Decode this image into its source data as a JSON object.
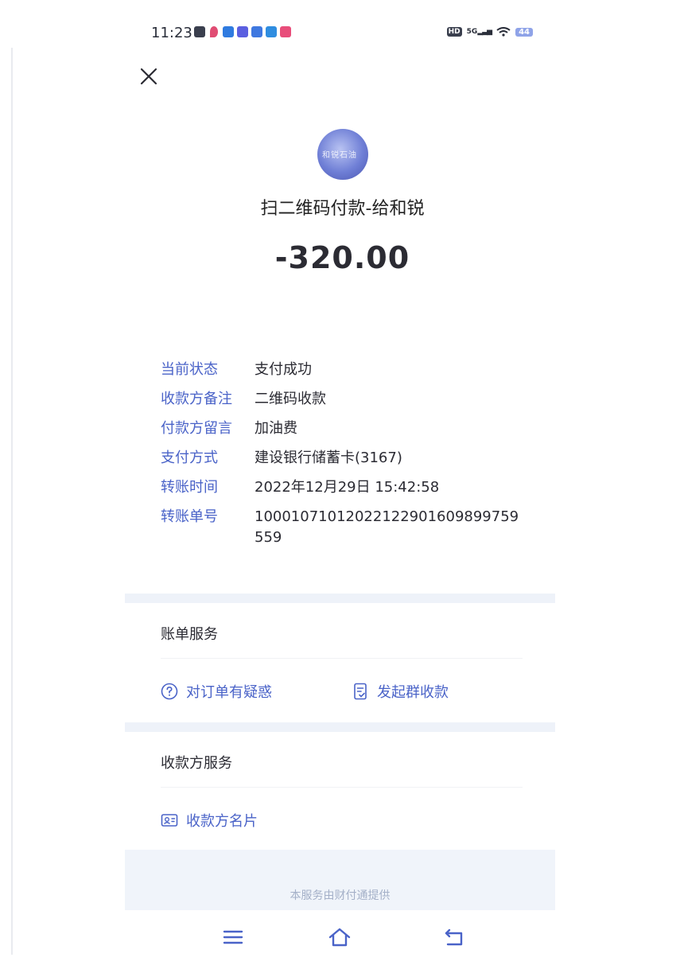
{
  "status_bar": {
    "time": "11:23",
    "signal_label": "5G",
    "hd_label": "HD",
    "battery": "44",
    "app_icon_colors": [
      "#3a3f4e",
      "#e04c73",
      "#2f7be0",
      "#5b5fe0",
      "#3f78e0",
      "#2f8de0",
      "#e84d7a"
    ]
  },
  "header": {
    "close_icon": "close-icon",
    "avatar_text": "和锐石油",
    "title": "扫二维码付款-给和锐",
    "amount": "-320.00"
  },
  "details": [
    {
      "label": "当前状态",
      "value": "支付成功"
    },
    {
      "label": "收款方备注",
      "value": "二维码收款"
    },
    {
      "label": "付款方留言",
      "value": "加油费"
    },
    {
      "label": "支付方式",
      "value": "建设银行储蓄卡(3167)"
    },
    {
      "label": "转账时间",
      "value": "2022年12月29日 15:42:58"
    },
    {
      "label": "转账单号",
      "value": "10001071012022122901609899759559"
    }
  ],
  "bill_service": {
    "title": "账单服务",
    "actions": [
      {
        "label": "对订单有疑惑",
        "icon": "question-circle-icon"
      },
      {
        "label": "发起群收款",
        "icon": "checklist-doc-icon"
      }
    ]
  },
  "payee_service": {
    "title": "收款方服务",
    "actions": [
      {
        "label": "收款方名片",
        "icon": "contact-card-icon"
      }
    ]
  },
  "footer": {
    "provider_text": "本服务由财付通提供"
  },
  "nav": {
    "menu_icon": "menu-icon",
    "home_icon": "home-icon",
    "back_icon": "back-icon"
  },
  "colors": {
    "accent": "#4a63c8",
    "text": "#2b2b33",
    "separator": "#eef2f9"
  }
}
